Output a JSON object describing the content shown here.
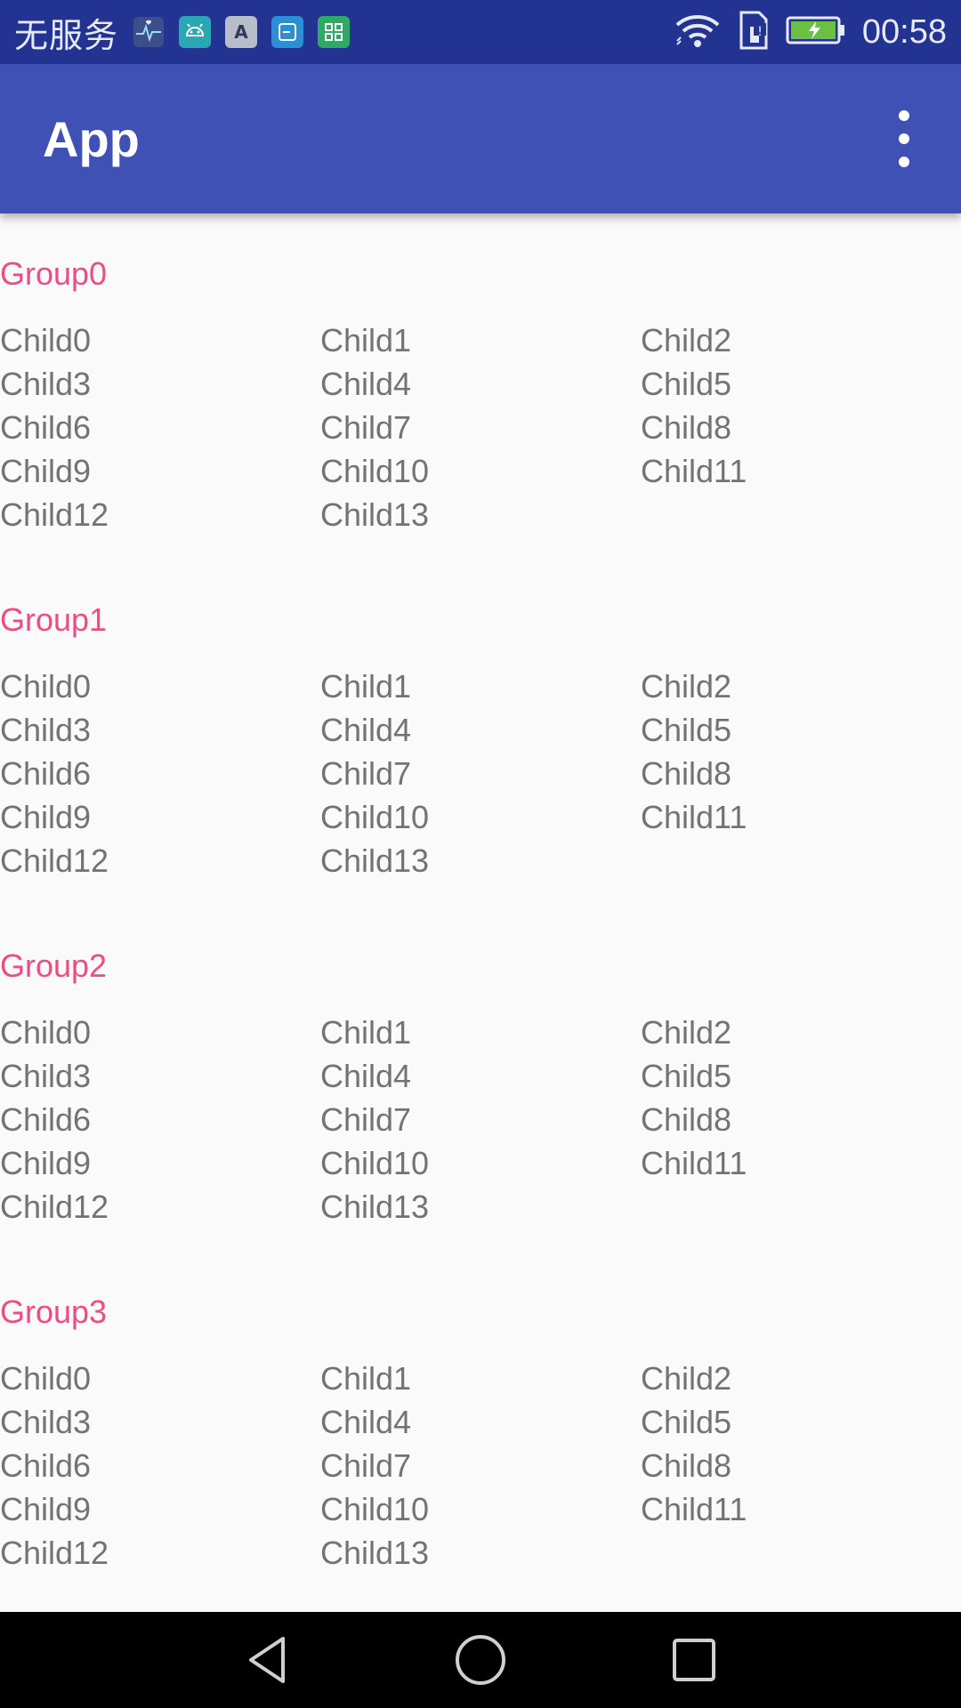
{
  "status_bar": {
    "carrier": "无服务",
    "notification_icons": [
      "health-icon",
      "android-icon",
      "font-icon",
      "app-icon",
      "grid-icon"
    ],
    "time": "00:58",
    "system_icons": [
      "wifi-icon",
      "sim-icon",
      "battery-charging-icon"
    ]
  },
  "app_bar": {
    "title": "App",
    "menu_icon": "overflow-menu-icon"
  },
  "groups": [
    {
      "title": "Group0",
      "children": [
        "Child0",
        "Child1",
        "Child2",
        "Child3",
        "Child4",
        "Child5",
        "Child6",
        "Child7",
        "Child8",
        "Child9",
        "Child10",
        "Child11",
        "Child12",
        "Child13"
      ]
    },
    {
      "title": "Group1",
      "children": [
        "Child0",
        "Child1",
        "Child2",
        "Child3",
        "Child4",
        "Child5",
        "Child6",
        "Child7",
        "Child8",
        "Child9",
        "Child10",
        "Child11",
        "Child12",
        "Child13"
      ]
    },
    {
      "title": "Group2",
      "children": [
        "Child0",
        "Child1",
        "Child2",
        "Child3",
        "Child4",
        "Child5",
        "Child6",
        "Child7",
        "Child8",
        "Child9",
        "Child10",
        "Child11",
        "Child12",
        "Child13"
      ]
    },
    {
      "title": "Group3",
      "children": [
        "Child0",
        "Child1",
        "Child2",
        "Child3",
        "Child4",
        "Child5",
        "Child6",
        "Child7",
        "Child8",
        "Child9",
        "Child10",
        "Child11",
        "Child12",
        "Child13"
      ]
    }
  ],
  "nav_bar": {
    "buttons": [
      "back-icon",
      "home-icon",
      "recents-icon"
    ]
  },
  "colors": {
    "status_bar": "#233392",
    "app_bar": "#3f51b5",
    "group_title": "#ef4c82",
    "child_text": "#737373",
    "background": "#fafafa"
  }
}
